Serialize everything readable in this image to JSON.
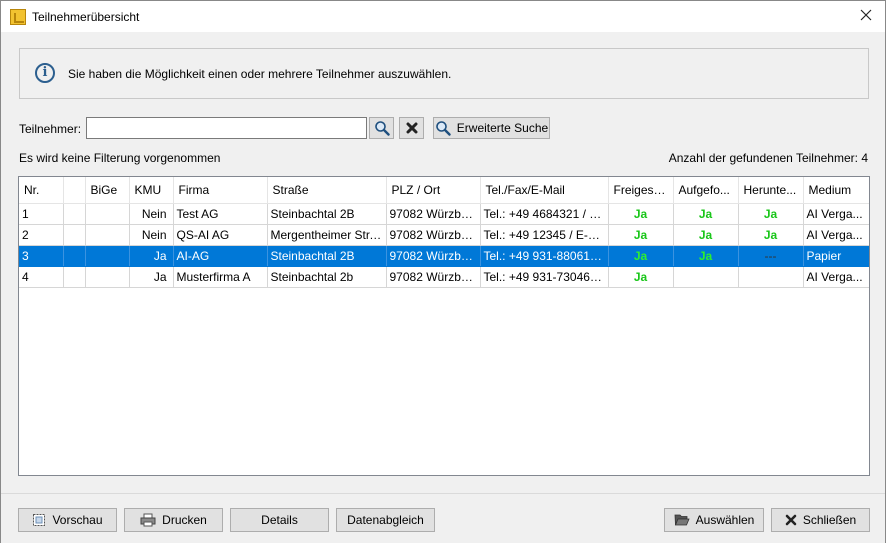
{
  "window": {
    "title": "Teilnehmerübersicht"
  },
  "info": {
    "text": "Sie haben die Möglichkeit einen oder mehrere Teilnehmer auszuwählen."
  },
  "search": {
    "label": "Teilnehmer:",
    "value": "",
    "advanced_label": "Erweiterte Suche"
  },
  "status": {
    "filter_text": "Es wird keine Filterung vorgenommen",
    "count_text": "Anzahl der gefundenen Teilnehmer: 4"
  },
  "table": {
    "columns": [
      "Nr.",
      "",
      "BiGe",
      "KMU",
      "Firma",
      "Straße",
      "PLZ / Ort",
      "Tel./Fax/E-Mail",
      "Freigesc...",
      "Aufgefo...",
      "Herunte...",
      "Medium"
    ],
    "rows": [
      [
        "1",
        "",
        "",
        "Nein",
        "Test AG",
        "Steinbachtal 2B",
        "97082 Würzburg",
        "Tel.: +49 4684321 / E-...",
        "Ja",
        "Ja",
        "Ja",
        "AI Verga..."
      ],
      [
        "2",
        "",
        "",
        "Nein",
        "QS-AI AG",
        "Mergentheimer Str. ...",
        "97082 Würzburg",
        "Tel.: +49 12345 / E-Ma...",
        "Ja",
        "Ja",
        "Ja",
        "AI Verga..."
      ],
      [
        "3",
        "",
        "",
        "Ja",
        "AI-AG",
        "Steinbachtal 2B",
        "97082 Würzburg",
        "Tel.: +49 931-8806143 ...",
        "Ja",
        "Ja",
        "---",
        "Papier"
      ],
      [
        "4",
        "",
        "",
        "Ja",
        "Musterfirma A",
        "Steinbachtal 2b",
        "97082 Würzburg",
        "Tel.: +49 931-7304620...",
        "Ja",
        "",
        "",
        "AI Verga..."
      ]
    ],
    "selected_row": 3
  },
  "footer": {
    "preview_label": "Vorschau",
    "print_label": "Drucken",
    "details_label": "Details",
    "sync_label": "Datenabgleich",
    "select_label": "Auswählen",
    "close_label": "Schließen"
  },
  "colors": {
    "selection": "#0078d7",
    "yes_green": "#19c619",
    "info_blue": "#2c5f8f"
  }
}
